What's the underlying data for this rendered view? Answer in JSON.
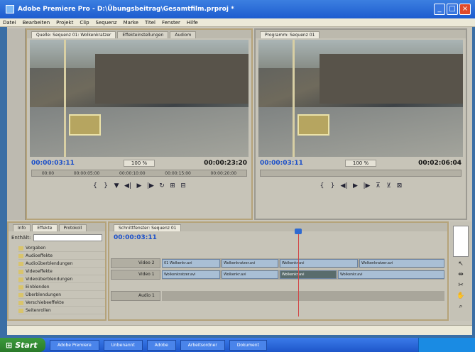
{
  "window": {
    "title": "Adobe Premiere Pro - D:\\Übungsbeitrag\\Gesamtfilm.prproj *"
  },
  "menu": [
    "Datei",
    "Bearbeiten",
    "Projekt",
    "Clip",
    "Sequenz",
    "Marke",
    "Titel",
    "Fenster",
    "Hilfe"
  ],
  "source_monitor": {
    "tabs": [
      "Quelle: Sequenz 01: Wolkenkratzer",
      "Effekteinstellungen",
      "Audiom"
    ],
    "current_time": "00:00:03:11",
    "zoom": "100 %",
    "duration": "00:00:23:20",
    "ruler_labels": [
      "00:00",
      "00:00:05:00",
      "00:00:10:00",
      "00:00:15:00",
      "00:00:20:00"
    ]
  },
  "program_monitor": {
    "tabs": [
      "Programm: Sequenz 01"
    ],
    "current_time": "00:00:03:11",
    "zoom": "100 %",
    "duration": "00:02:06:04"
  },
  "effects_panel": {
    "tabs": [
      "Info",
      "Effekte",
      "Protokoll"
    ],
    "search_label": "Enthält:",
    "items": [
      "Vorgaben",
      "Audioeffekte",
      "Audioüberblendungen",
      "Videoeffekte",
      "Videoüberblendungen",
      "Einblenden",
      "Überblendungen",
      "Verschiebeeffekte",
      "Seitenrollen"
    ]
  },
  "timeline": {
    "tab": "Schnittfenster: Sequenz 01",
    "current_time": "00:00:03:11",
    "tracks": [
      {
        "name": "Video 2",
        "clips": [
          "01 Wolkenkr.avi",
          "Wolkenkratzer.avi",
          "Wolkenkr.avi",
          "Wolkenkratzer.avi"
        ]
      },
      {
        "name": "Video 1",
        "clips": [
          "Wolkenkratzer.avi",
          "Wolkenkr.avi",
          "Wolkenkr.avi",
          "Wolkenkr.avi"
        ]
      },
      {
        "name": "Audio 1",
        "clips": []
      }
    ]
  },
  "taskbar": {
    "start": "Start",
    "items": [
      "Adobe Premiere",
      "Unbenannt",
      "Adobe",
      "Arbeitsordner",
      "Dokument"
    ],
    "clock": ""
  }
}
